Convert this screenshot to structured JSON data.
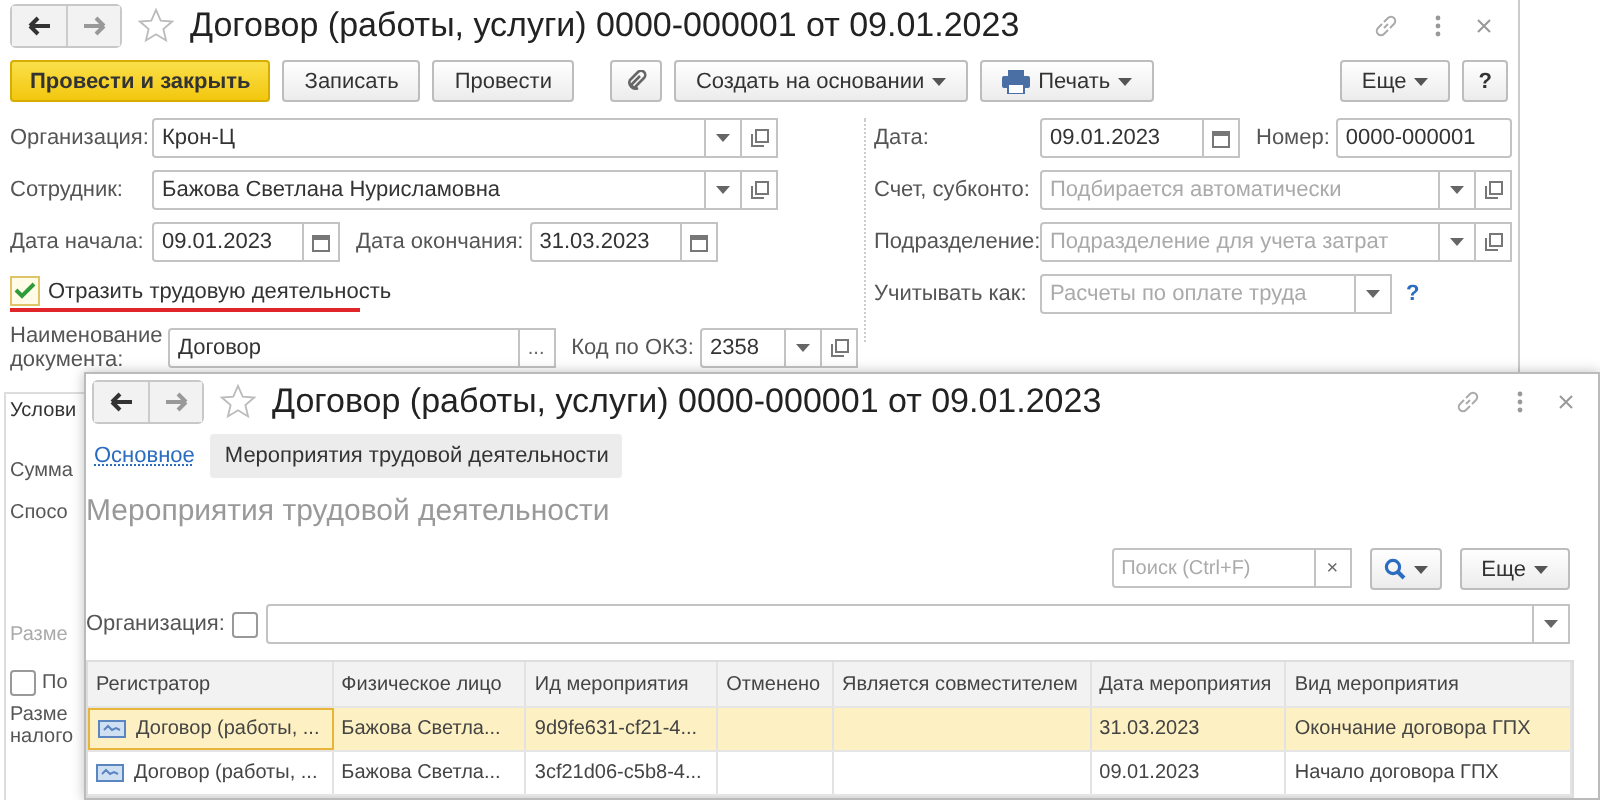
{
  "back_window": {
    "title": "Договор (работы, услуги) 0000-000001 от 09.01.2023",
    "toolbar": [
      {
        "kind": "primary",
        "label": "Провести и закрыть"
      },
      {
        "kind": "plain",
        "label": "Записать"
      },
      {
        "kind": "plain",
        "label": "Провести"
      },
      {
        "kind": "attach"
      },
      {
        "kind": "menu",
        "label": "Создать на основании"
      },
      {
        "kind": "print",
        "label": "Печать"
      }
    ],
    "more": "Еще",
    "help": "?",
    "organization": {
      "label": "Организация:",
      "value": "Крон-Ц"
    },
    "employee": {
      "label": "Сотрудник:",
      "value": "Бажова Светлана Нурисламовна"
    },
    "start_date": {
      "label": "Дата начала:",
      "value": "09.01.2023"
    },
    "end_date": {
      "label": "Дата окончания:",
      "value": "31.03.2023"
    },
    "reflect": {
      "label": "Отразить трудовую деятельность",
      "checked": true
    },
    "doc_name": {
      "label": "Наименование документа:",
      "value": "Договор",
      "choose": "..."
    },
    "okz": {
      "label": "Код по ОКЗ:",
      "value": "2358"
    },
    "date": {
      "label": "Дата:",
      "value": "09.01.2023"
    },
    "number": {
      "label": "Номер:",
      "value": "0000-000001"
    },
    "account": {
      "label": "Счет, субконто:",
      "placeholder": "Подбирается автоматически"
    },
    "department": {
      "label": "Подразделение:",
      "placeholder": "Подразделение для учета затрат"
    },
    "account_as": {
      "label": "Учитывать как:",
      "placeholder": "Расчеты по оплате труда",
      "help": "?"
    },
    "group_tab": "Услови",
    "group_items": [
      {
        "kind": "label",
        "text": "Сумма"
      },
      {
        "kind": "label",
        "text": "Спосо"
      },
      {
        "kind": "muted",
        "text": "Разме"
      },
      {
        "kind": "checkbox",
        "text": "По",
        "checked": false
      },
      {
        "kind": "label",
        "text": "Разме"
      },
      {
        "kind": "label",
        "text": "налого"
      }
    ]
  },
  "front_window": {
    "title": "Договор (работы, услуги) 0000-000001 от 09.01.2023",
    "tabs": [
      {
        "label": "Основное",
        "selected": false
      },
      {
        "label": "Мероприятия трудовой деятельности",
        "selected": true
      }
    ],
    "heading": "Мероприятия трудовой деятельности",
    "search": {
      "placeholder": "Поиск (Ctrl+F)",
      "clear": "×"
    },
    "more": "Еще",
    "org_filter": {
      "label": "Организация:",
      "checked": false
    },
    "columns": [
      "Регистратор",
      "Физическое лицо",
      "Ид мероприятия",
      "Отменено",
      "Является совместителем",
      "Дата мероприятия",
      "Вид мероприятия"
    ],
    "rows": [
      {
        "selected": true,
        "cells": [
          "Договор (работы, ...",
          "Бажова Светла...",
          "9d9fe631-cf21-4...",
          "",
          "",
          "31.03.2023",
          "Окончание договора ГПХ"
        ]
      },
      {
        "selected": false,
        "cells": [
          "Договор (работы, ...",
          "Бажова Светла...",
          "3cf21d06-c5b8-4...",
          "",
          "",
          "09.01.2023",
          "Начало договора ГПХ"
        ]
      }
    ]
  }
}
